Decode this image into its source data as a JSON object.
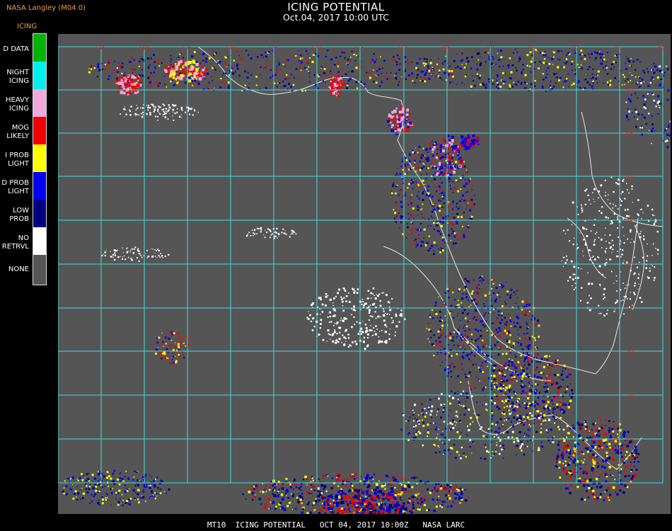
{
  "header": {
    "credit": "NASA Langley (M04.0)",
    "product": "ICING",
    "title": "ICING POTENTIAL",
    "subtitle": "Oct.04, 2017 10:00 UTC"
  },
  "legend": {
    "items": [
      {
        "label": "D DATA",
        "color": "#00b400"
      },
      {
        "label": "NIGHT\nICING",
        "color": "#00f0f0"
      },
      {
        "label": "HEAVY\nICING",
        "color": "#f0a8e0"
      },
      {
        "label": "MOG\nLIKELY",
        "color": "#f00000"
      },
      {
        "label": "I PROB\nLIGHT",
        "color": "#ffff00"
      },
      {
        "label": "D PROB\nLIGHT",
        "color": "#0000f0"
      },
      {
        "label": "LOW\nPROB",
        "color": "#000080"
      },
      {
        "label": "NO\nRETRVL",
        "color": "#ffffff"
      },
      {
        "label": "NONE",
        "color": "#555555"
      }
    ]
  },
  "map": {
    "background_color": "#555555",
    "grid_color": "#40e0e0",
    "lon_labels": [
      "145",
      "140",
      "135",
      "130",
      "125",
      "120",
      "115",
      "110",
      "105",
      "100",
      "95",
      "90",
      "85",
      "80"
    ],
    "lat_labels": [
      "50",
      "45",
      "40",
      "35",
      "30",
      "25",
      "20",
      "15",
      "10",
      "5",
      "0"
    ]
  },
  "footer": {
    "text": "MT10  ICING POTENTIAL   OCT 04, 2017 10:00Z   NASA LARC"
  }
}
